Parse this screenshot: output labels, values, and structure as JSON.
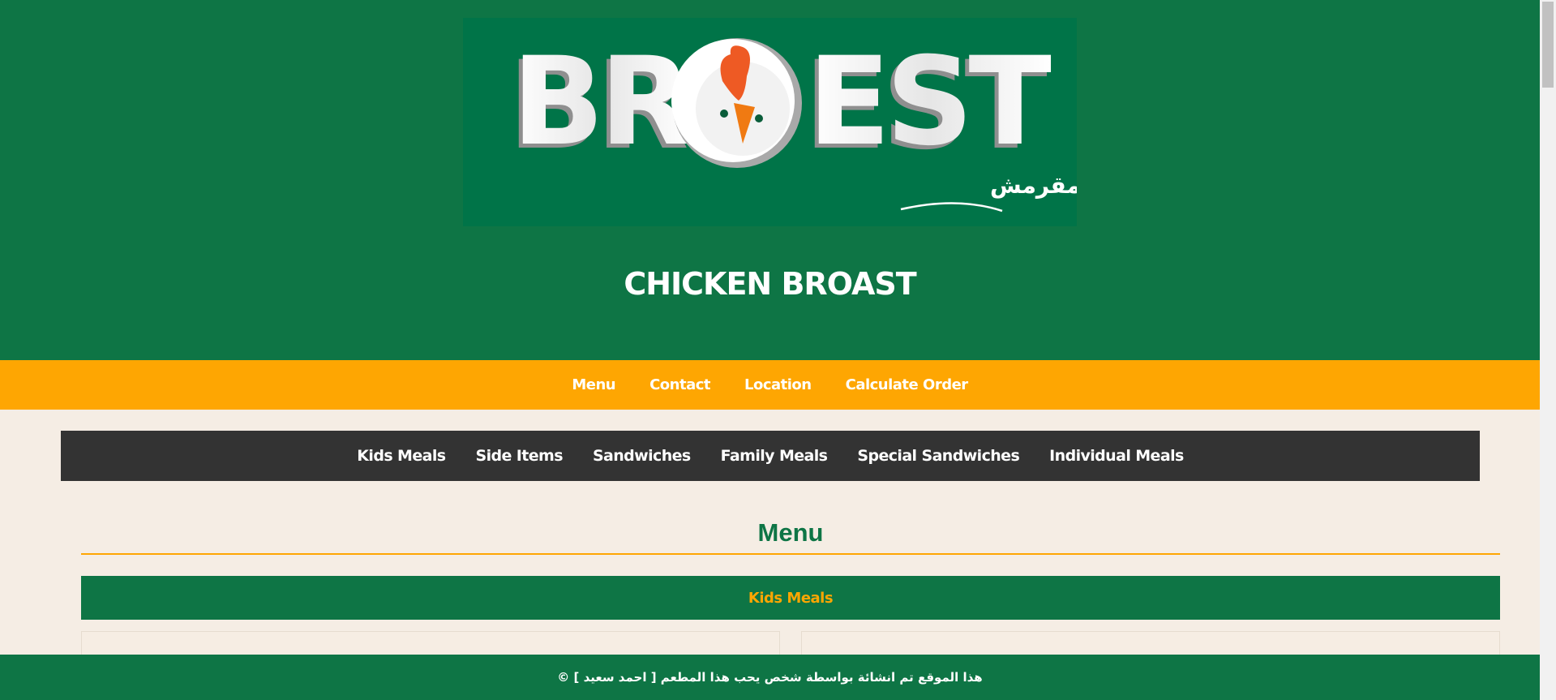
{
  "header": {
    "logo": {
      "text_latin": "BROEST",
      "text_arabic": "بروست دجاج مقرمش"
    },
    "title": "CHICKEN BROAST"
  },
  "top_nav": {
    "items": [
      "Menu",
      "Contact",
      "Location",
      "Calculate Order"
    ]
  },
  "category_nav": {
    "items": [
      "Kids Meals",
      "Side Items",
      "Sandwiches",
      "Family Meals",
      "Special Sandwiches",
      "Individual Meals"
    ]
  },
  "menu": {
    "heading": "Menu",
    "section_title": "Kids Meals"
  },
  "footer": {
    "text": "هذا الموقع تم انشائة بواسطة شخص يحب هذا المطعم [ احمد سعيد ] ©"
  },
  "colors": {
    "header_green": "#0e7545",
    "accent_orange": "#fea602",
    "dark_nav": "#333333",
    "page_background": "#f5ede4"
  }
}
